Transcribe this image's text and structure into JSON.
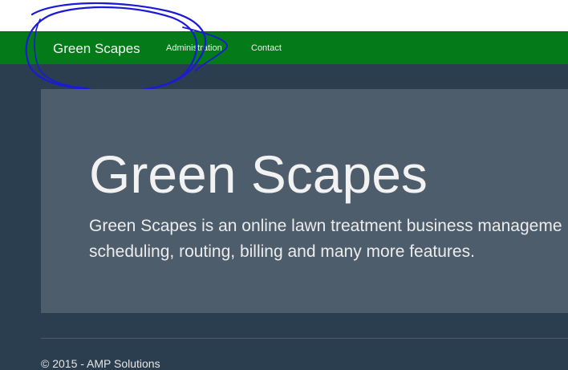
{
  "navbar": {
    "brand": "Green Scapes",
    "links": [
      {
        "label": "Administration"
      },
      {
        "label": "Contact"
      }
    ]
  },
  "hero": {
    "title": "Green Scapes",
    "lines": [
      "Green Scapes is an online lawn treatment business manageme",
      "scheduling, routing, billing and many more features."
    ]
  },
  "footer": {
    "text": "© 2015 - AMP Solutions"
  },
  "colors": {
    "navbar": "#047a18",
    "page_background": "#2b3e50",
    "jumbotron": "#4e5d6c",
    "annotation_ink": "#1a1ad8"
  }
}
